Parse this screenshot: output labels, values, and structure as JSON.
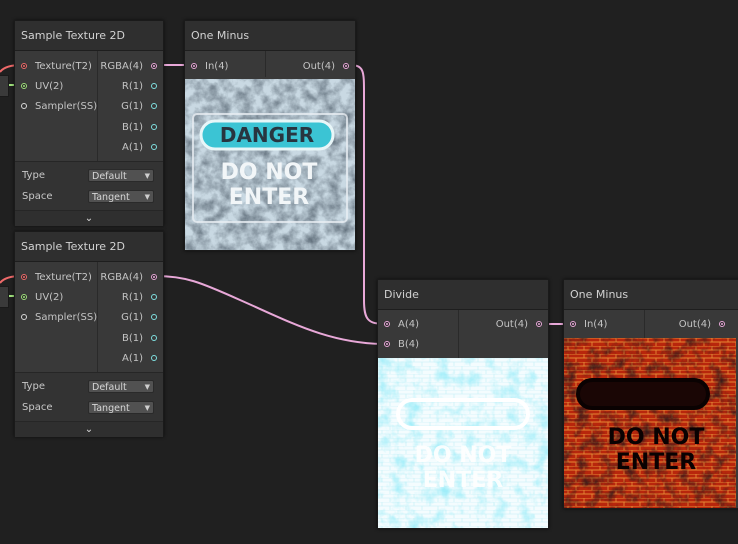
{
  "nodes": {
    "sample1": {
      "title": "Sample Texture 2D",
      "inputs": [
        "Texture(T2)",
        "UV(2)",
        "Sampler(SS)"
      ],
      "outputs": [
        "RGBA(4)",
        "R(1)",
        "G(1)",
        "B(1)",
        "A(1)"
      ],
      "type_label": "Type",
      "type_value": "Default",
      "space_label": "Space",
      "space_value": "Tangent",
      "expander": "⌄"
    },
    "sample2": {
      "title": "Sample Texture 2D",
      "inputs": [
        "Texture(T2)",
        "UV(2)",
        "Sampler(SS)"
      ],
      "outputs": [
        "RGBA(4)",
        "R(1)",
        "G(1)",
        "B(1)",
        "A(1)"
      ],
      "type_label": "Type",
      "type_value": "Default",
      "space_label": "Space",
      "space_value": "Tangent",
      "expander": "⌄"
    },
    "oneminus1": {
      "title": "One Minus",
      "input": "In(4)",
      "output": "Out(4)"
    },
    "divide": {
      "title": "Divide",
      "input_a": "A(4)",
      "input_b": "B(4)",
      "output": "Out(4)"
    },
    "oneminus2": {
      "title": "One Minus",
      "input": "In(4)",
      "output": "Out(4)"
    }
  },
  "preview_text": {
    "danger": "DANGER",
    "line1": "DO NOT",
    "line2": "ENTER"
  },
  "colors": {
    "wire_vector": "#e8a8d8",
    "wire_texture": "#ef6a6a",
    "wire_uv": "#9fe07c"
  }
}
